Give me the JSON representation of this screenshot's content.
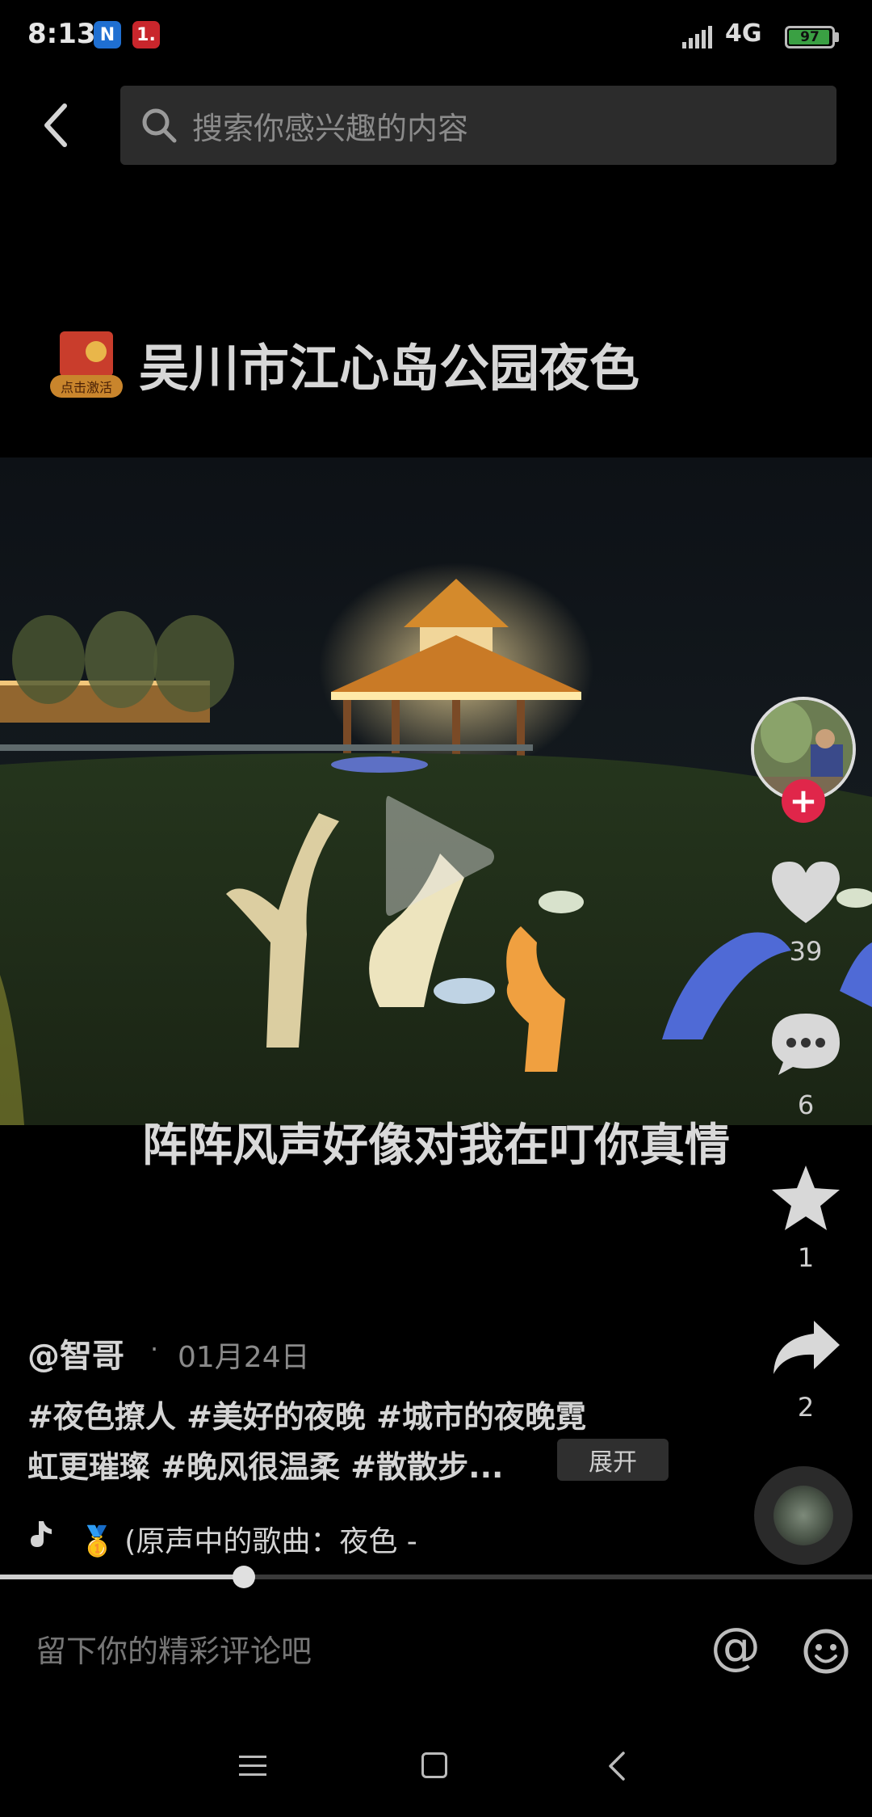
{
  "status_bar": {
    "time": "8:13",
    "notif_1": "N",
    "notif_2": "1.",
    "network": "4G",
    "battery_level": "97"
  },
  "search": {
    "placeholder": "搜索你感兴趣的内容"
  },
  "video": {
    "title": "吴川市江心岛公园夜色",
    "badge_label": "点击激活",
    "subtitle": "阵阵风声好像对我在叮你真情",
    "progress_percent": 28
  },
  "actions": {
    "likes": "39",
    "comments": "6",
    "favorites": "1",
    "shares": "2"
  },
  "post": {
    "author": "@智哥",
    "separator": "·",
    "date": "01月24日",
    "desc_line_1": "#夜色撩人 #美好的夜晚 #城市的夜晚霓",
    "desc_line_2": "虹更璀璨 #晚风很温柔 #散散步...",
    "expand_label": "展开",
    "music": "🥇 (原声中的歌曲：夜色 -"
  },
  "comment_bar": {
    "placeholder": "留下你的精彩评论吧",
    "at_symbol": "@"
  },
  "colors": {
    "accent_red": "#e0264a",
    "battery_green": "#3aa043"
  }
}
